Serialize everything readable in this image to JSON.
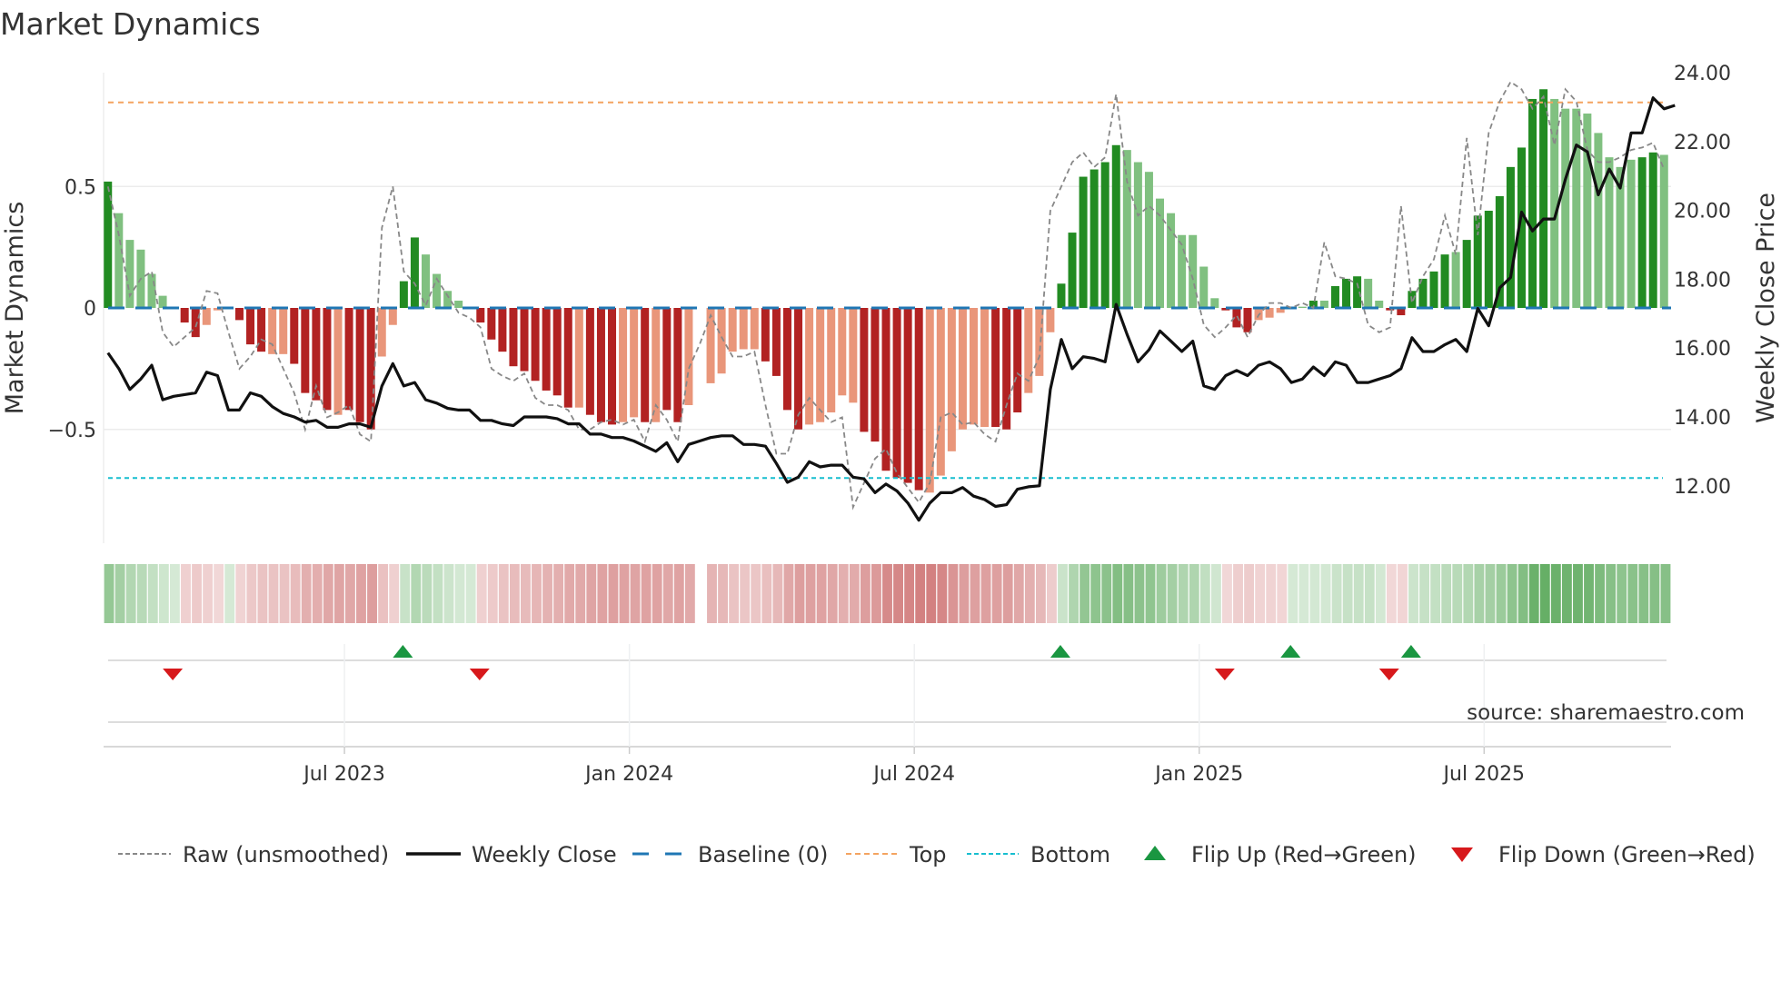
{
  "title": "Market Dynamics",
  "source": "source: sharemaestro.com",
  "colors": {
    "strong_green": "#228b22",
    "weak_green": "#80c080",
    "strong_red": "#b22222",
    "weak_red": "#e9967a",
    "close": "#111111",
    "raw": "#888888",
    "baseline": "#1f77b4",
    "top": "#f4a460",
    "bottom": "#17becf",
    "flip_up": "#1a9641",
    "flip_down": "#d7191c"
  },
  "chart_data": {
    "type": "bar",
    "title": "Market Dynamics",
    "ylabel": "Market Dynamics",
    "ylabel_right": "Weekly Close Price",
    "ylim": [
      -0.98,
      0.97
    ],
    "ylim_right": [
      10.6,
      24.5
    ],
    "yticks": [
      {
        "v": 0.5,
        "label": "0.5"
      },
      {
        "v": 0,
        "label": "0"
      },
      {
        "v": -0.5,
        "label": "−0.5"
      }
    ],
    "yticks_right": [
      {
        "v": 24,
        "label": "24.00"
      },
      {
        "v": 22,
        "label": "22.00"
      },
      {
        "v": 20,
        "label": "20.00"
      },
      {
        "v": 18,
        "label": "18.00"
      },
      {
        "v": 16,
        "label": "16.00"
      },
      {
        "v": 14,
        "label": "14.00"
      },
      {
        "v": 12,
        "label": "12.00"
      }
    ],
    "xticks": [
      {
        "week": 22,
        "label": "Jul 2023"
      },
      {
        "week": 48,
        "label": "Jan 2024"
      },
      {
        "week": 74,
        "label": "Jul 2024"
      },
      {
        "week": 100,
        "label": "Jan 2025"
      },
      {
        "week": 126,
        "label": "Jul 2025"
      }
    ],
    "top_level": 0.846,
    "bottom_level": -0.7,
    "baseline": 0,
    "momentum": [
      0.52,
      0.39,
      0.28,
      0.24,
      0.14,
      0.05,
      0.0,
      -0.06,
      -0.12,
      -0.07,
      -0.01,
      0,
      -0.05,
      -0.15,
      -0.18,
      -0.19,
      -0.19,
      -0.23,
      -0.35,
      -0.38,
      -0.42,
      -0.44,
      -0.42,
      -0.47,
      -0.5,
      -0.2,
      -0.07,
      0.11,
      0.29,
      0.22,
      0.14,
      0.07,
      0.03,
      0.005,
      -0.06,
      -0.13,
      -0.18,
      -0.24,
      -0.26,
      -0.3,
      -0.34,
      -0.36,
      -0.41,
      -0.41,
      -0.44,
      -0.47,
      -0.48,
      -0.47,
      -0.45,
      -0.47,
      -0.47,
      -0.42,
      -0.47,
      -0.4,
      null,
      -0.31,
      -0.27,
      -0.18,
      -0.17,
      -0.17,
      -0.22,
      -0.28,
      -0.42,
      -0.5,
      -0.48,
      -0.47,
      -0.43,
      -0.36,
      -0.39,
      -0.51,
      -0.55,
      -0.67,
      -0.7,
      -0.72,
      -0.75,
      -0.76,
      -0.69,
      -0.59,
      -0.5,
      -0.48,
      -0.49,
      -0.49,
      -0.5,
      -0.43,
      -0.35,
      -0.28,
      -0.1,
      0.1,
      0.31,
      0.54,
      0.57,
      0.6,
      0.67,
      0.65,
      0.6,
      0.56,
      0.45,
      0.39,
      0.3,
      0.3,
      0.17,
      0.04,
      -0.01,
      -0.08,
      -0.1,
      -0.05,
      -0.04,
      -0.02,
      0,
      0.005,
      0.03,
      0.03,
      0.09,
      0.12,
      0.13,
      0.12,
      0.03,
      -0.01,
      -0.03,
      0.07,
      0.12,
      0.15,
      0.22,
      0.23,
      0.28,
      0.38,
      0.4,
      0.46,
      0.58,
      0.66,
      0.86,
      0.9,
      0.86,
      0.82,
      0.82,
      0.8,
      0.72,
      0.62,
      0.58,
      0.61,
      0.62,
      0.64,
      0.63
    ],
    "strong": [
      1,
      0,
      0,
      0,
      0,
      0,
      0,
      1,
      1,
      0,
      0,
      0,
      1,
      1,
      1,
      0,
      0,
      1,
      1,
      1,
      1,
      0,
      1,
      1,
      1,
      0,
      0,
      1,
      1,
      0,
      0,
      0,
      0,
      0,
      1,
      1,
      1,
      1,
      1,
      1,
      1,
      1,
      1,
      0,
      1,
      1,
      1,
      0,
      0,
      1,
      0,
      1,
      1,
      0,
      0,
      0,
      0,
      0,
      0,
      0,
      1,
      1,
      1,
      1,
      0,
      0,
      0,
      0,
      0,
      1,
      1,
      1,
      1,
      1,
      1,
      0,
      0,
      0,
      0,
      0,
      0,
      1,
      1,
      1,
      0,
      0,
      0,
      1,
      1,
      1,
      1,
      1,
      1,
      0,
      0,
      0,
      0,
      0,
      0,
      0,
      0,
      0,
      1,
      1,
      1,
      0,
      0,
      0,
      0,
      0,
      1,
      0,
      1,
      1,
      1,
      0,
      0,
      1,
      1,
      1,
      1,
      1,
      1,
      0,
      1,
      1,
      1,
      1,
      1,
      1,
      1,
      1,
      0,
      0,
      0,
      0,
      0,
      0,
      0,
      0,
      1,
      1,
      0
    ],
    "raw": [
      0.5,
      0.3,
      0.05,
      0.12,
      0.15,
      -0.1,
      -0.16,
      -0.12,
      -0.08,
      0.07,
      0.06,
      -0.1,
      -0.25,
      -0.2,
      -0.13,
      -0.15,
      -0.25,
      -0.35,
      -0.5,
      -0.32,
      -0.45,
      -0.43,
      -0.4,
      -0.52,
      -0.55,
      0.33,
      0.5,
      0.15,
      0.1,
      0.01,
      0.12,
      0.05,
      -0.02,
      -0.04,
      -0.08,
      -0.25,
      -0.28,
      -0.3,
      -0.27,
      -0.37,
      -0.4,
      -0.4,
      -0.42,
      -0.5,
      -0.5,
      -0.47,
      -0.46,
      -0.48,
      -0.46,
      -0.55,
      -0.4,
      -0.46,
      -0.55,
      -0.25,
      -0.15,
      -0.03,
      -0.12,
      -0.2,
      -0.2,
      -0.18,
      -0.4,
      -0.6,
      -0.6,
      -0.44,
      -0.37,
      -0.42,
      -0.47,
      -0.45,
      -0.82,
      -0.72,
      -0.62,
      -0.58,
      -0.68,
      -0.74,
      -0.8,
      -0.72,
      -0.45,
      -0.43,
      -0.48,
      -0.47,
      -0.52,
      -0.55,
      -0.4,
      -0.27,
      -0.3,
      -0.2,
      0.4,
      0.5,
      0.6,
      0.64,
      0.58,
      0.62,
      0.88,
      0.52,
      0.38,
      0.42,
      0.38,
      0.32,
      0.26,
      0.12,
      -0.07,
      -0.12,
      -0.08,
      -0.03,
      -0.12,
      -0.03,
      0.02,
      0.02,
      0.0,
      0.02,
      0.0,
      0.27,
      0.13,
      0.12,
      0.1,
      -0.07,
      -0.1,
      -0.08,
      0.42,
      0.02,
      0.13,
      0.2,
      0.38,
      0.22,
      0.7,
      0.3,
      0.72,
      0.85,
      0.93,
      0.9,
      0.82,
      0.87,
      0.67,
      0.9,
      0.85,
      0.65,
      0.6,
      0.6,
      0.62,
      0.65,
      0.66,
      0.68,
      0.57
    ],
    "close": [
      15.86,
      15.4,
      14.8,
      15.1,
      15.5,
      14.5,
      14.6,
      14.65,
      14.7,
      15.3,
      15.2,
      14.2,
      14.2,
      14.7,
      14.6,
      14.3,
      14.1,
      14.0,
      13.85,
      13.9,
      13.7,
      13.7,
      13.8,
      13.8,
      13.7,
      14.9,
      15.55,
      14.9,
      15.0,
      14.5,
      14.4,
      14.25,
      14.2,
      14.2,
      13.9,
      13.9,
      13.8,
      13.75,
      14.0,
      14.0,
      14.0,
      13.95,
      13.8,
      13.8,
      13.5,
      13.5,
      13.4,
      13.4,
      13.3,
      13.15,
      13.0,
      13.25,
      12.7,
      13.2,
      13.3,
      13.4,
      13.45,
      13.45,
      13.2,
      13.2,
      13.15,
      12.65,
      12.1,
      12.25,
      12.7,
      12.55,
      12.6,
      12.6,
      12.25,
      12.2,
      11.8,
      12.05,
      11.85,
      11.5,
      11.0,
      11.5,
      11.8,
      11.8,
      11.95,
      11.7,
      11.6,
      11.4,
      11.45,
      11.9,
      11.97,
      12.0,
      14.8,
      16.25,
      15.4,
      15.75,
      15.7,
      15.6,
      17.27,
      16.4,
      15.6,
      15.95,
      16.5,
      16.2,
      15.9,
      16.2,
      14.9,
      14.8,
      15.2,
      15.35,
      15.2,
      15.5,
      15.6,
      15.4,
      15.0,
      15.1,
      15.45,
      15.2,
      15.6,
      15.5,
      15.0,
      15.0,
      15.1,
      15.2,
      15.4,
      16.3,
      15.9,
      15.9,
      16.1,
      16.25,
      15.9,
      17.15,
      16.65,
      17.75,
      18.05,
      19.95,
      19.4,
      19.75,
      19.75,
      20.9,
      21.9,
      21.7,
      20.45,
      21.2,
      20.65,
      22.25,
      22.25,
      23.27,
      22.95,
      23.05
    ],
    "flip_up_weeks": [
      27,
      87,
      108,
      119
    ],
    "flip_down_weeks": [
      6,
      34,
      102,
      117
    ],
    "legend": [
      {
        "key": "raw",
        "label": "Raw (unsmoothed)"
      },
      {
        "key": "close",
        "label": "Weekly Close"
      },
      {
        "key": "baseline",
        "label": "Baseline (0)"
      },
      {
        "key": "top",
        "label": "Top"
      },
      {
        "key": "bottom",
        "label": "Bottom"
      },
      {
        "key": "flip_up",
        "label": "Flip Up (Red→Green)"
      },
      {
        "key": "flip_down",
        "label": "Flip Down (Green→Red)"
      }
    ],
    "legend_position": "bottom"
  }
}
